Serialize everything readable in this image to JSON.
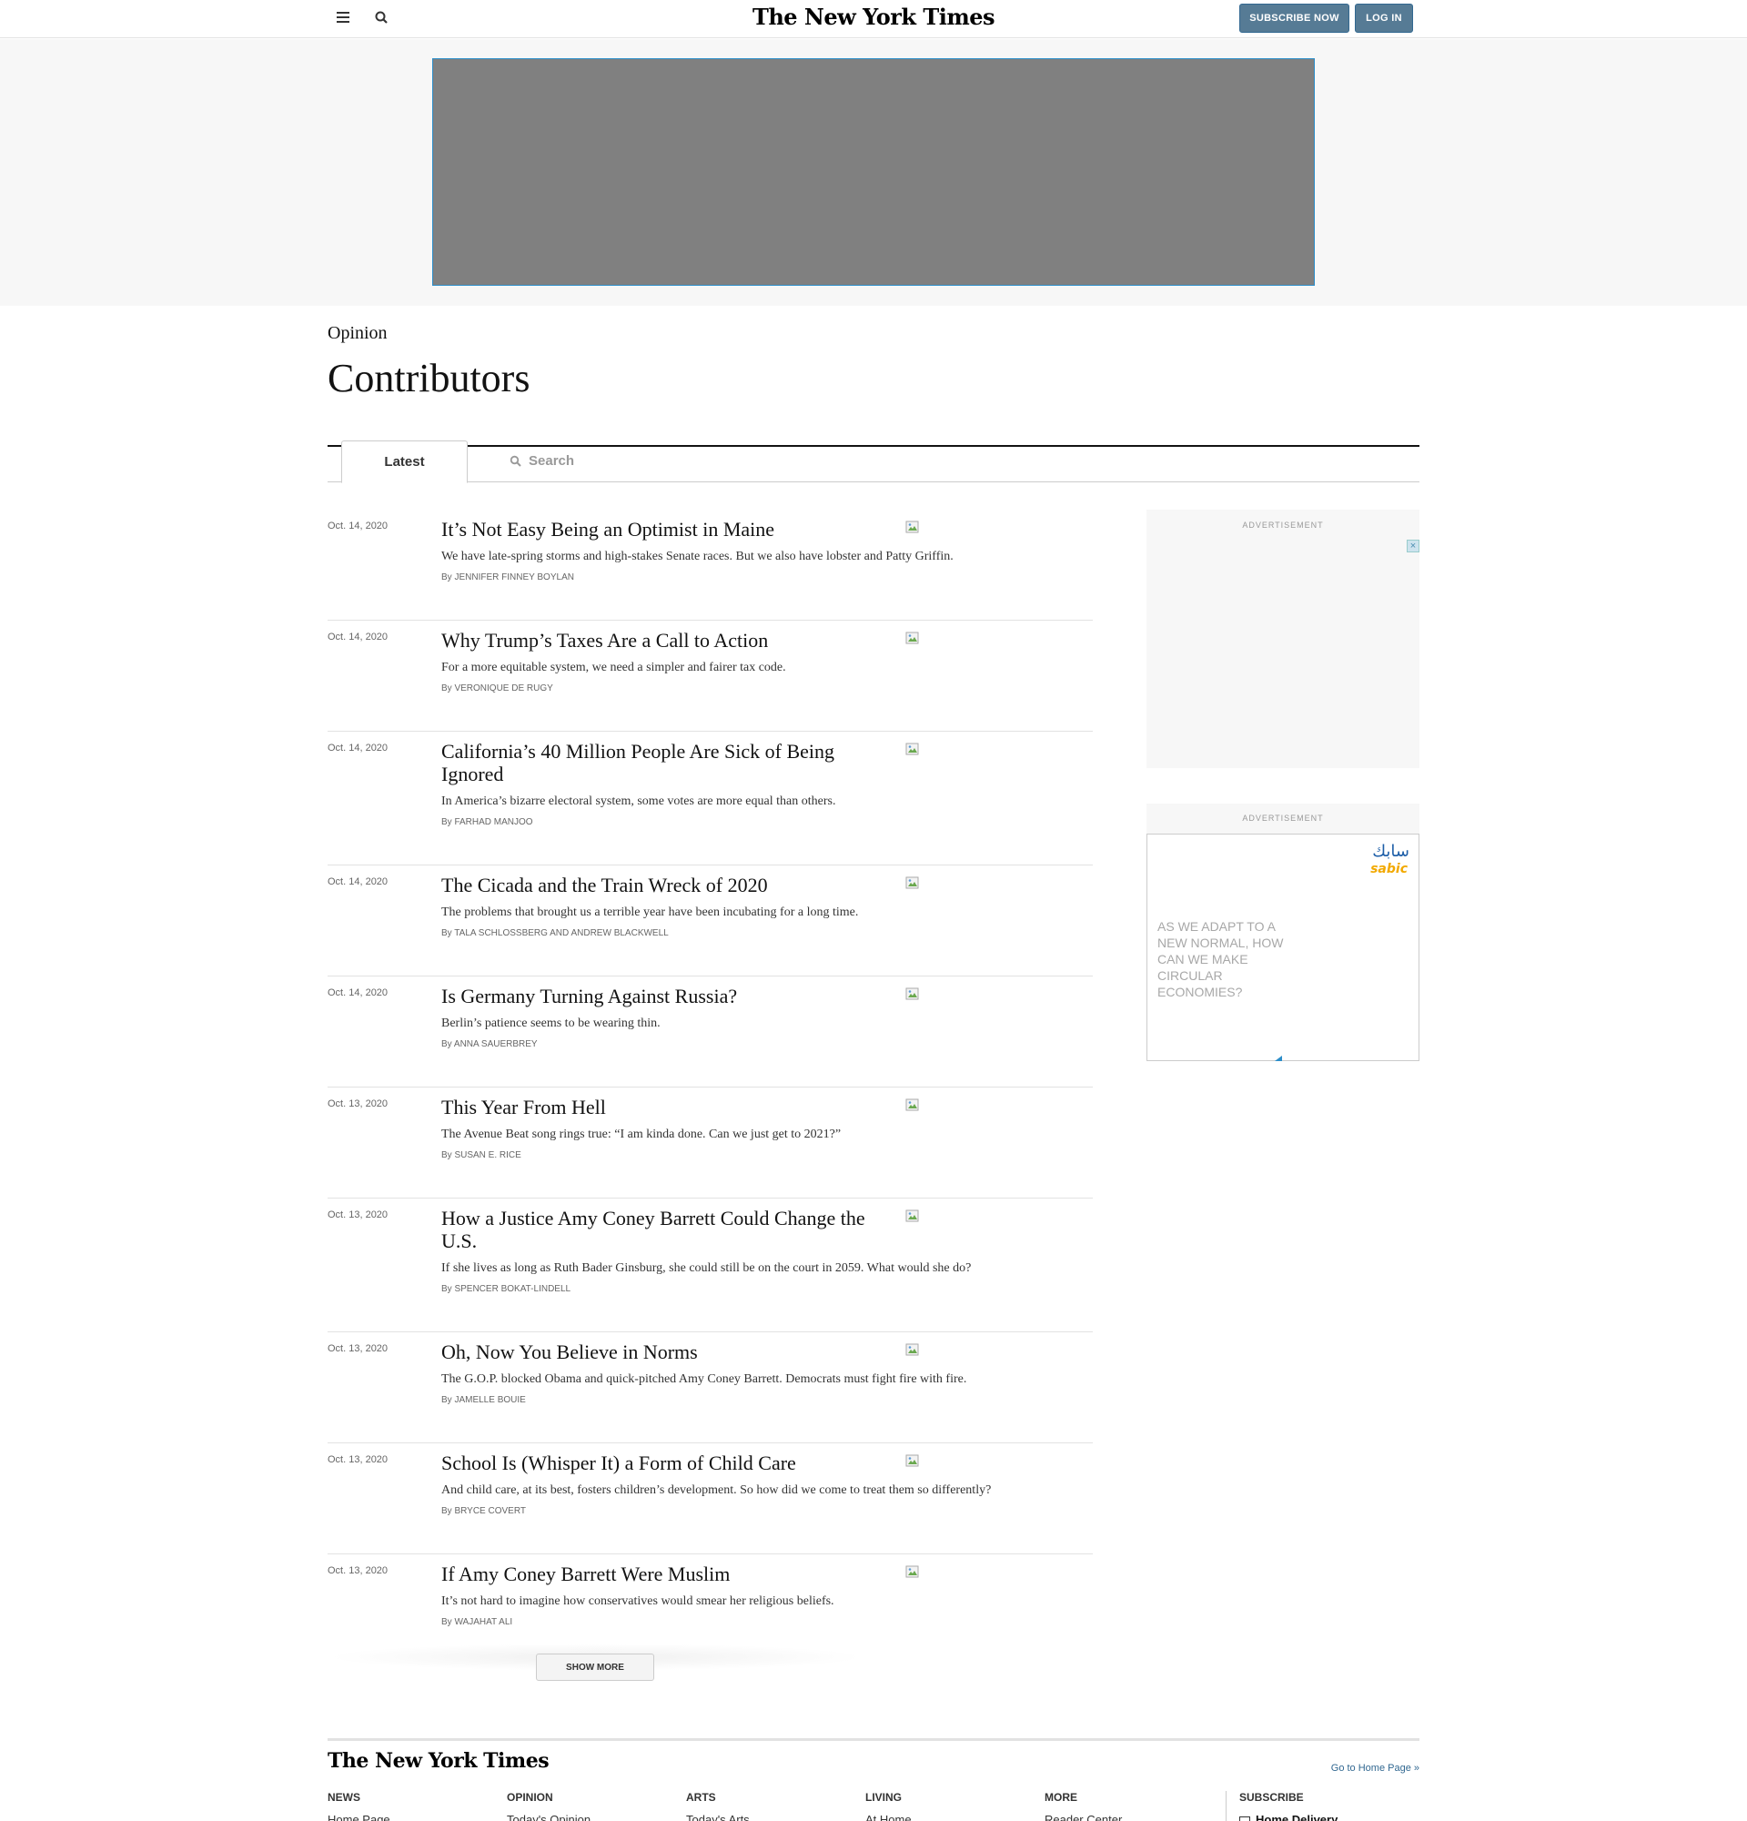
{
  "topbar": {
    "masthead": "The New York Times",
    "subscribe_label": "SUBSCRIBE NOW",
    "login_label": "LOG IN"
  },
  "header": {
    "kicker": "Opinion",
    "title": "Contributors"
  },
  "tabs": {
    "latest_label": "Latest",
    "search_label": "Search"
  },
  "articles": [
    {
      "date": "Oct. 14, 2020",
      "headline": "It’s Not Easy Being an Optimist in Maine",
      "summary": "We have late-spring storms and high-stakes Senate races. But we also have lobster and Patty Griffin.",
      "by": "By",
      "author": "JENNIFER FINNEY BOYLAN"
    },
    {
      "date": "Oct. 14, 2020",
      "headline": "Why Trump’s Taxes Are a Call to Action",
      "summary": "For a more equitable system, we need a simpler and fairer tax code.",
      "by": "By",
      "author": "VERONIQUE DE RUGY"
    },
    {
      "date": "Oct. 14, 2020",
      "headline": "California’s 40 Million People Are Sick of Being Ignored",
      "summary": "In America’s bizarre electoral system, some votes are more equal than others.",
      "by": "By",
      "author": "FARHAD MANJOO"
    },
    {
      "date": "Oct. 14, 2020",
      "headline": "The Cicada and the Train Wreck of 2020",
      "summary": "The problems that brought us a terrible year have been incubating for a long time.",
      "by": "By",
      "author": "TALA SCHLOSSBERG and ANDREW BLACKWELL"
    },
    {
      "date": "Oct. 14, 2020",
      "headline": "Is Germany Turning Against Russia?",
      "summary": "Berlin’s patience seems to be wearing thin.",
      "by": "By",
      "author": "ANNA SAUERBREY"
    },
    {
      "date": "Oct. 13, 2020",
      "headline": "This Year From Hell",
      "summary": "The Avenue Beat song rings true: “I am kinda done. Can we just get to 2021?”",
      "by": "By",
      "author": "SUSAN E. RICE"
    },
    {
      "date": "Oct. 13, 2020",
      "headline": "How a Justice Amy Coney Barrett Could Change the U.S.",
      "summary": "If she lives as long as Ruth Bader Ginsburg, she could still be on the court in 2059. What would she do?",
      "by": "By",
      "author": "SPENCER BOKAT-LINDELL"
    },
    {
      "date": "Oct. 13, 2020",
      "headline": "Oh, Now You Believe in Norms",
      "summary": "The G.O.P. blocked Obama and quick-pitched Amy Coney Barrett. Democrats must fight fire with fire.",
      "by": "By",
      "author": "JAMELLE BOUIE"
    },
    {
      "date": "Oct. 13, 2020",
      "headline": "School Is (Whisper It) a Form of Child Care",
      "summary": "And child care, at its best, fosters children’s development. So how did we come to treat them so differently?",
      "by": "By",
      "author": "BRYCE COVERT"
    },
    {
      "date": "Oct. 13, 2020",
      "headline": "If Amy Coney Barrett Were Muslim",
      "summary": "It’s not hard to imagine how conservatives would smear her religious beliefs.",
      "by": "By",
      "author": "WAJAHAT ALI"
    }
  ],
  "show_more_label": "SHOW MORE",
  "sidebar": {
    "ad1_label": "ADVERTISEMENT",
    "ad2_label": "ADVERTISEMENT",
    "ad_close_glyph": "×",
    "sabic_arabic": "سابك",
    "sabic_latin": "sabic",
    "sabic_text": "AS WE ADAPT TO A NEW NORMAL, HOW CAN WE MAKE CIRCULAR ECONOMIES?"
  },
  "footer": {
    "logo": "The New York Times",
    "home_link": "Go to Home Page »",
    "columns": [
      "NEWS",
      "OPINION",
      "ARTS",
      "LIVING",
      "MORE",
      "SUBSCRIBE"
    ],
    "first_links": [
      "Home Page",
      "Today's Opinion",
      "Today's Arts",
      "At Home",
      "Reader Center"
    ],
    "subscribe_link": "Home Delivery"
  },
  "colors": {
    "accent_blue": "#567b95",
    "link_blue": "#326891",
    "ad_gray": "#808080"
  }
}
